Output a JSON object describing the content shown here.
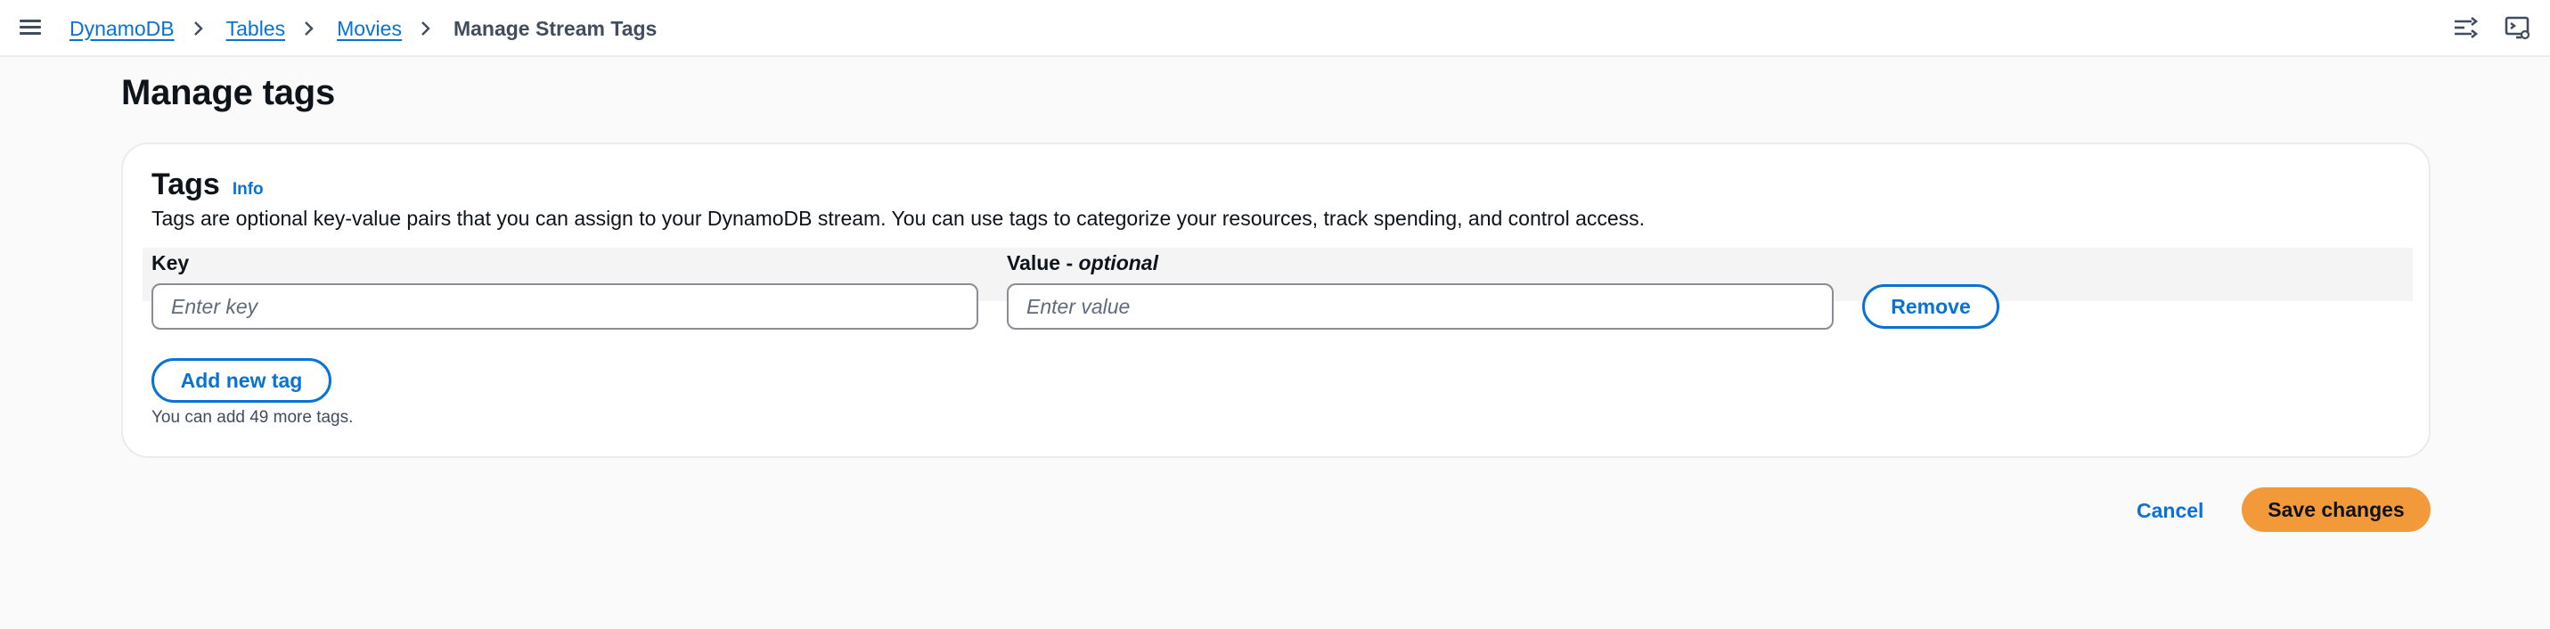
{
  "breadcrumb": {
    "items": [
      {
        "label": "DynamoDB"
      },
      {
        "label": "Tables"
      },
      {
        "label": "Movies"
      }
    ],
    "current": "Manage Stream Tags"
  },
  "page": {
    "title": "Manage tags"
  },
  "tags_panel": {
    "title": "Tags",
    "info_label": "Info",
    "description": "Tags are optional key-value pairs that you can assign to your DynamoDB stream. You can use tags to categorize your resources, track spending, and control access.",
    "key_label": "Key",
    "value_label": "Value - ",
    "value_optional": "optional",
    "key_value": "",
    "key_placeholder": "Enter key",
    "value_value": "",
    "value_placeholder": "Enter value",
    "remove_label": "Remove",
    "add_label": "Add new tag",
    "limit_text": "You can add 49 more tags."
  },
  "actions": {
    "cancel_label": "Cancel",
    "save_label": "Save changes"
  },
  "icons": {
    "menu": "hamburger-menu-icon",
    "separator": "chevron-right-icon",
    "top_right_1": "split-view-icon",
    "top_right_2": "preferences-screen-icon"
  },
  "colors": {
    "link": "#0972d3",
    "primary_button": "#f2993a",
    "background": "#fafafa",
    "card": "#ffffff"
  }
}
